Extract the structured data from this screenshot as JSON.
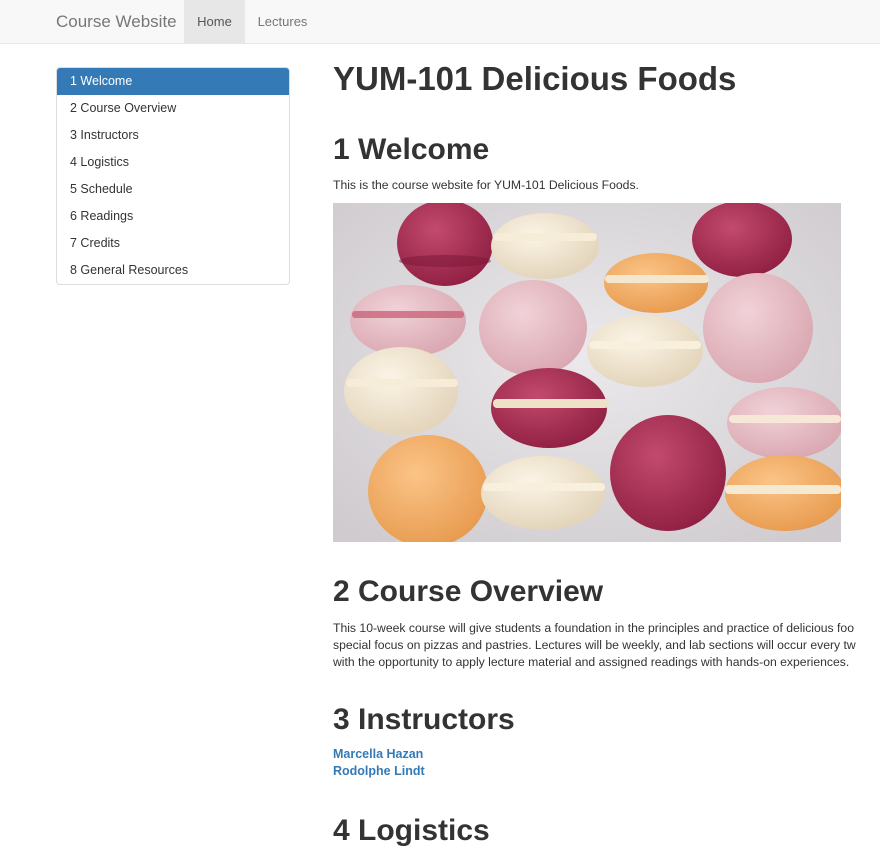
{
  "navbar": {
    "brand": "Course Website",
    "links": [
      {
        "label": "Home",
        "active": true
      },
      {
        "label": "Lectures",
        "active": false
      }
    ]
  },
  "toc": {
    "items": [
      {
        "label": "1 Welcome",
        "active": true
      },
      {
        "label": "2 Course Overview",
        "active": false
      },
      {
        "label": "3 Instructors",
        "active": false
      },
      {
        "label": "4 Logistics",
        "active": false
      },
      {
        "label": "5 Schedule",
        "active": false
      },
      {
        "label": "6 Readings",
        "active": false
      },
      {
        "label": "7 Credits",
        "active": false
      },
      {
        "label": "8 General Resources",
        "active": false
      }
    ]
  },
  "main": {
    "title": "YUM-101 Delicious Foods",
    "welcome": {
      "heading": "1 Welcome",
      "text": "This is the course website for YUM-101 Delicious Foods."
    },
    "overview": {
      "heading": "2 Course Overview",
      "lines": [
        "This 10-week course will give students a foundation in the principles and practice of delicious foo",
        "special focus on pizzas and pastries. Lectures will be weekly, and lab sections will occur every tw",
        "with the opportunity to apply lecture material and assigned readings with hands-on experiences."
      ]
    },
    "instructors": {
      "heading": "3 Instructors",
      "names": [
        "Marcella Hazan",
        "Rodolphe Lindt"
      ]
    },
    "logistics": {
      "heading": "4 Logistics"
    }
  },
  "colors": {
    "accent": "#337ab7",
    "navbar_bg": "#f8f8f8",
    "text": "#333333"
  }
}
